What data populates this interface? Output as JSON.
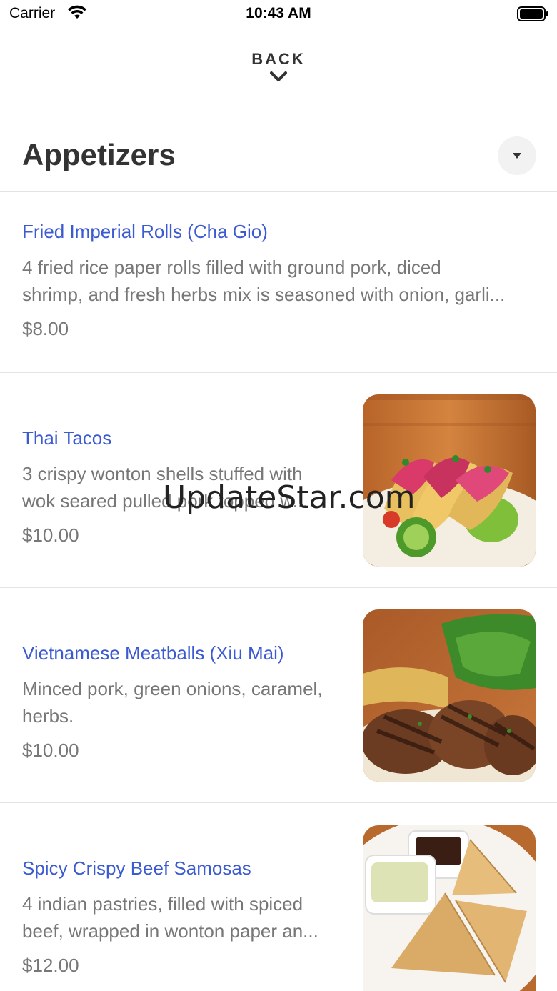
{
  "status_bar": {
    "carrier": "Carrier",
    "time": "10:43 AM"
  },
  "nav": {
    "back_label": "BACK"
  },
  "section": {
    "title": "Appetizers"
  },
  "items": [
    {
      "name": "Fried Imperial Rolls (Cha Gio)",
      "desc_lines": [
        "4 fried rice paper rolls filled with ground pork, diced",
        "shrimp, and fresh herbs mix is seasoned with onion, garli..."
      ],
      "price": "$8.00"
    },
    {
      "name": "Thai Tacos",
      "desc_lines": [
        "3 crispy wonton shells stuffed with",
        "wok seared pulled pork topped w..."
      ],
      "price": "$10.00",
      "image": "thai-tacos-photo"
    },
    {
      "name": "Vietnamese Meatballs (Xiu Mai)",
      "desc_lines": [
        "Minced pork, green onions, caramel,",
        "herbs."
      ],
      "price": "$10.00",
      "image": "meatballs-photo"
    },
    {
      "name": "Spicy Crispy Beef Samosas",
      "desc_lines": [
        "4 indian pastries, filled with spiced",
        "beef, wrapped in wonton paper an..."
      ],
      "price": "$12.00",
      "image": "samosas-photo"
    }
  ],
  "watermark": "UpdateStar.com",
  "colors": {
    "link": "#3c5bd0",
    "muted": "#777777",
    "heading": "#333333"
  }
}
